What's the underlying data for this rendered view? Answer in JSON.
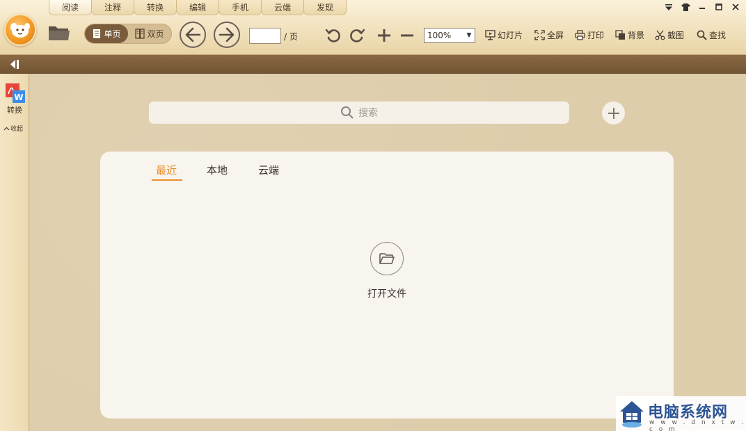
{
  "tabs": [
    "阅读",
    "注释",
    "转换",
    "编辑",
    "手机",
    "云端",
    "发现"
  ],
  "active_tab": 0,
  "window_controls": {
    "menu_icon": "menu-dropdown-icon",
    "skin_icon": "skin-shirt-icon",
    "minimize_icon": "minimize-icon",
    "maximize_icon": "maximize-icon",
    "close_icon": "close-icon"
  },
  "toolbar": {
    "single_page_label": "单页",
    "double_page_label": "双页",
    "page_value": "",
    "page_separator": "/ 页",
    "zoom_value": "100%",
    "slideshow_label": "幻灯片",
    "fullscreen_label": "全屏",
    "print_label": "打印",
    "background_label": "背景",
    "screenshot_label": "截图",
    "find_label": "查找"
  },
  "sidebar": {
    "convert_label": "转换",
    "collapse_label": "收起",
    "convert_badge": "W"
  },
  "main": {
    "search_placeholder": "搜索",
    "panel_tabs": [
      "最近",
      "本地",
      "云端"
    ],
    "active_panel_tab": 0,
    "open_file_label": "打开文件"
  },
  "watermark": {
    "title": "电脑系统网",
    "url": "w w w . d n x t w . c o m"
  },
  "colors": {
    "accent": "#e8902c",
    "toolbar_bg": "#f3e4c2",
    "strip_bg": "#7a5b3c",
    "main_bg": "#decdab",
    "panel_bg": "#f8f4ee"
  }
}
